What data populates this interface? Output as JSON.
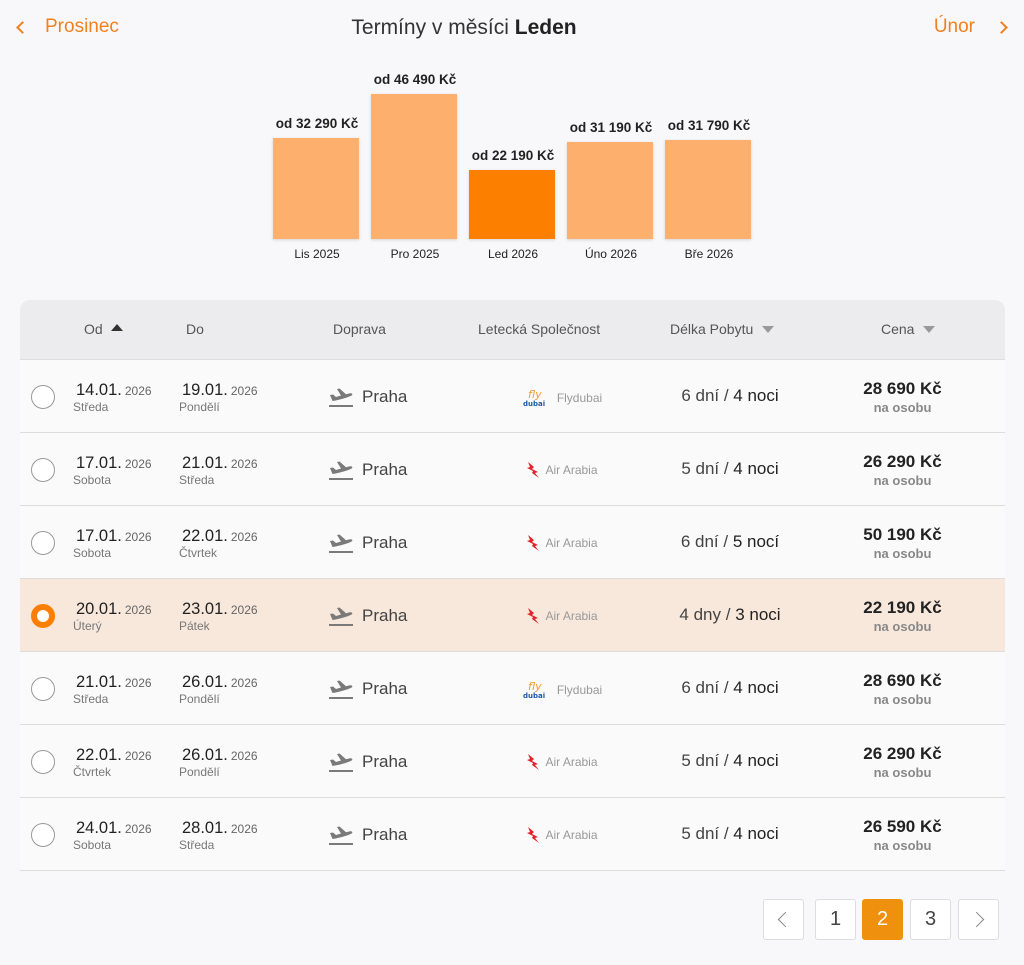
{
  "nav": {
    "prev_label": "Prosinec",
    "next_label": "Únor",
    "title_prefix": "Termíny v měsíci",
    "title_month": "Leden"
  },
  "chart_data": {
    "type": "bar",
    "categories": [
      "Lis 2025",
      "Pro 2025",
      "Led 2026",
      "Úno 2026",
      "Bře 2026"
    ],
    "values": [
      32290,
      46490,
      22190,
      31190,
      31790
    ],
    "labels": [
      "od 32 290 Kč",
      "od 46 490 Kč",
      "od 22 190 Kč",
      "od 31 190 Kč",
      "od 31 790 Kč"
    ],
    "selected_index": 2,
    "colors": {
      "bar": "#fdb06e",
      "selected": "#fc7f00"
    }
  },
  "table": {
    "headers": {
      "from": "Od",
      "to": "Do",
      "transport": "Doprava",
      "airline": "Letecká Společnost",
      "stay": "Délka Pobytu",
      "price": "Cena"
    },
    "rows": [
      {
        "from_date": "14.01.",
        "from_year": "2026",
        "from_day": "Středa",
        "to_date": "19.01.",
        "to_year": "2026",
        "to_day": "Pondělí",
        "transport": "Praha",
        "airline": "Flydubai",
        "airline_logo": "flydubai-logo",
        "days": "6 dní",
        "nights": "4 noci",
        "price": "28 690 Kč",
        "per": "na osobu",
        "selected": false
      },
      {
        "from_date": "17.01.",
        "from_year": "2026",
        "from_day": "Sobota",
        "to_date": "21.01.",
        "to_year": "2026",
        "to_day": "Středa",
        "transport": "Praha",
        "airline": "Air Arabia",
        "airline_logo": "air-arabia-logo",
        "days": "5 dní",
        "nights": "4 noci",
        "price": "26 290 Kč",
        "per": "na osobu",
        "selected": false
      },
      {
        "from_date": "17.01.",
        "from_year": "2026",
        "from_day": "Sobota",
        "to_date": "22.01.",
        "to_year": "2026",
        "to_day": "Čtvrtek",
        "transport": "Praha",
        "airline": "Air Arabia",
        "airline_logo": "air-arabia-logo",
        "days": "6 dní",
        "nights": "5 nocí",
        "price": "50 190 Kč",
        "per": "na osobu",
        "selected": false
      },
      {
        "from_date": "20.01.",
        "from_year": "2026",
        "from_day": "Úterý",
        "to_date": "23.01.",
        "to_year": "2026",
        "to_day": "Pátek",
        "transport": "Praha",
        "airline": "Air Arabia",
        "airline_logo": "air-arabia-logo",
        "days": "4 dny",
        "nights": "3 noci",
        "price": "22 190 Kč",
        "per": "na osobu",
        "selected": true
      },
      {
        "from_date": "21.01.",
        "from_year": "2026",
        "from_day": "Středa",
        "to_date": "26.01.",
        "to_year": "2026",
        "to_day": "Pondělí",
        "transport": "Praha",
        "airline": "Flydubai",
        "airline_logo": "flydubai-logo",
        "days": "6 dní",
        "nights": "4 noci",
        "price": "28 690 Kč",
        "per": "na osobu",
        "selected": false
      },
      {
        "from_date": "22.01.",
        "from_year": "2026",
        "from_day": "Čtvrtek",
        "to_date": "26.01.",
        "to_year": "2026",
        "to_day": "Pondělí",
        "transport": "Praha",
        "airline": "Air Arabia",
        "airline_logo": "air-arabia-logo",
        "days": "5 dní",
        "nights": "4 noci",
        "price": "26 290 Kč",
        "per": "na osobu",
        "selected": false
      },
      {
        "from_date": "24.01.",
        "from_year": "2026",
        "from_day": "Sobota",
        "to_date": "28.01.",
        "to_year": "2026",
        "to_day": "Středa",
        "transport": "Praha",
        "airline": "Air Arabia",
        "airline_logo": "air-arabia-logo",
        "days": "5 dní",
        "nights": "4 noci",
        "price": "26 590 Kč",
        "per": "na osobu",
        "selected": false
      }
    ]
  },
  "pagination": {
    "pages": [
      "1",
      "2",
      "3"
    ],
    "active": "2"
  },
  "colors": {
    "accent": "#f0811f",
    "selected_row": "#f8e8dc",
    "active_page": "#f0900f"
  }
}
